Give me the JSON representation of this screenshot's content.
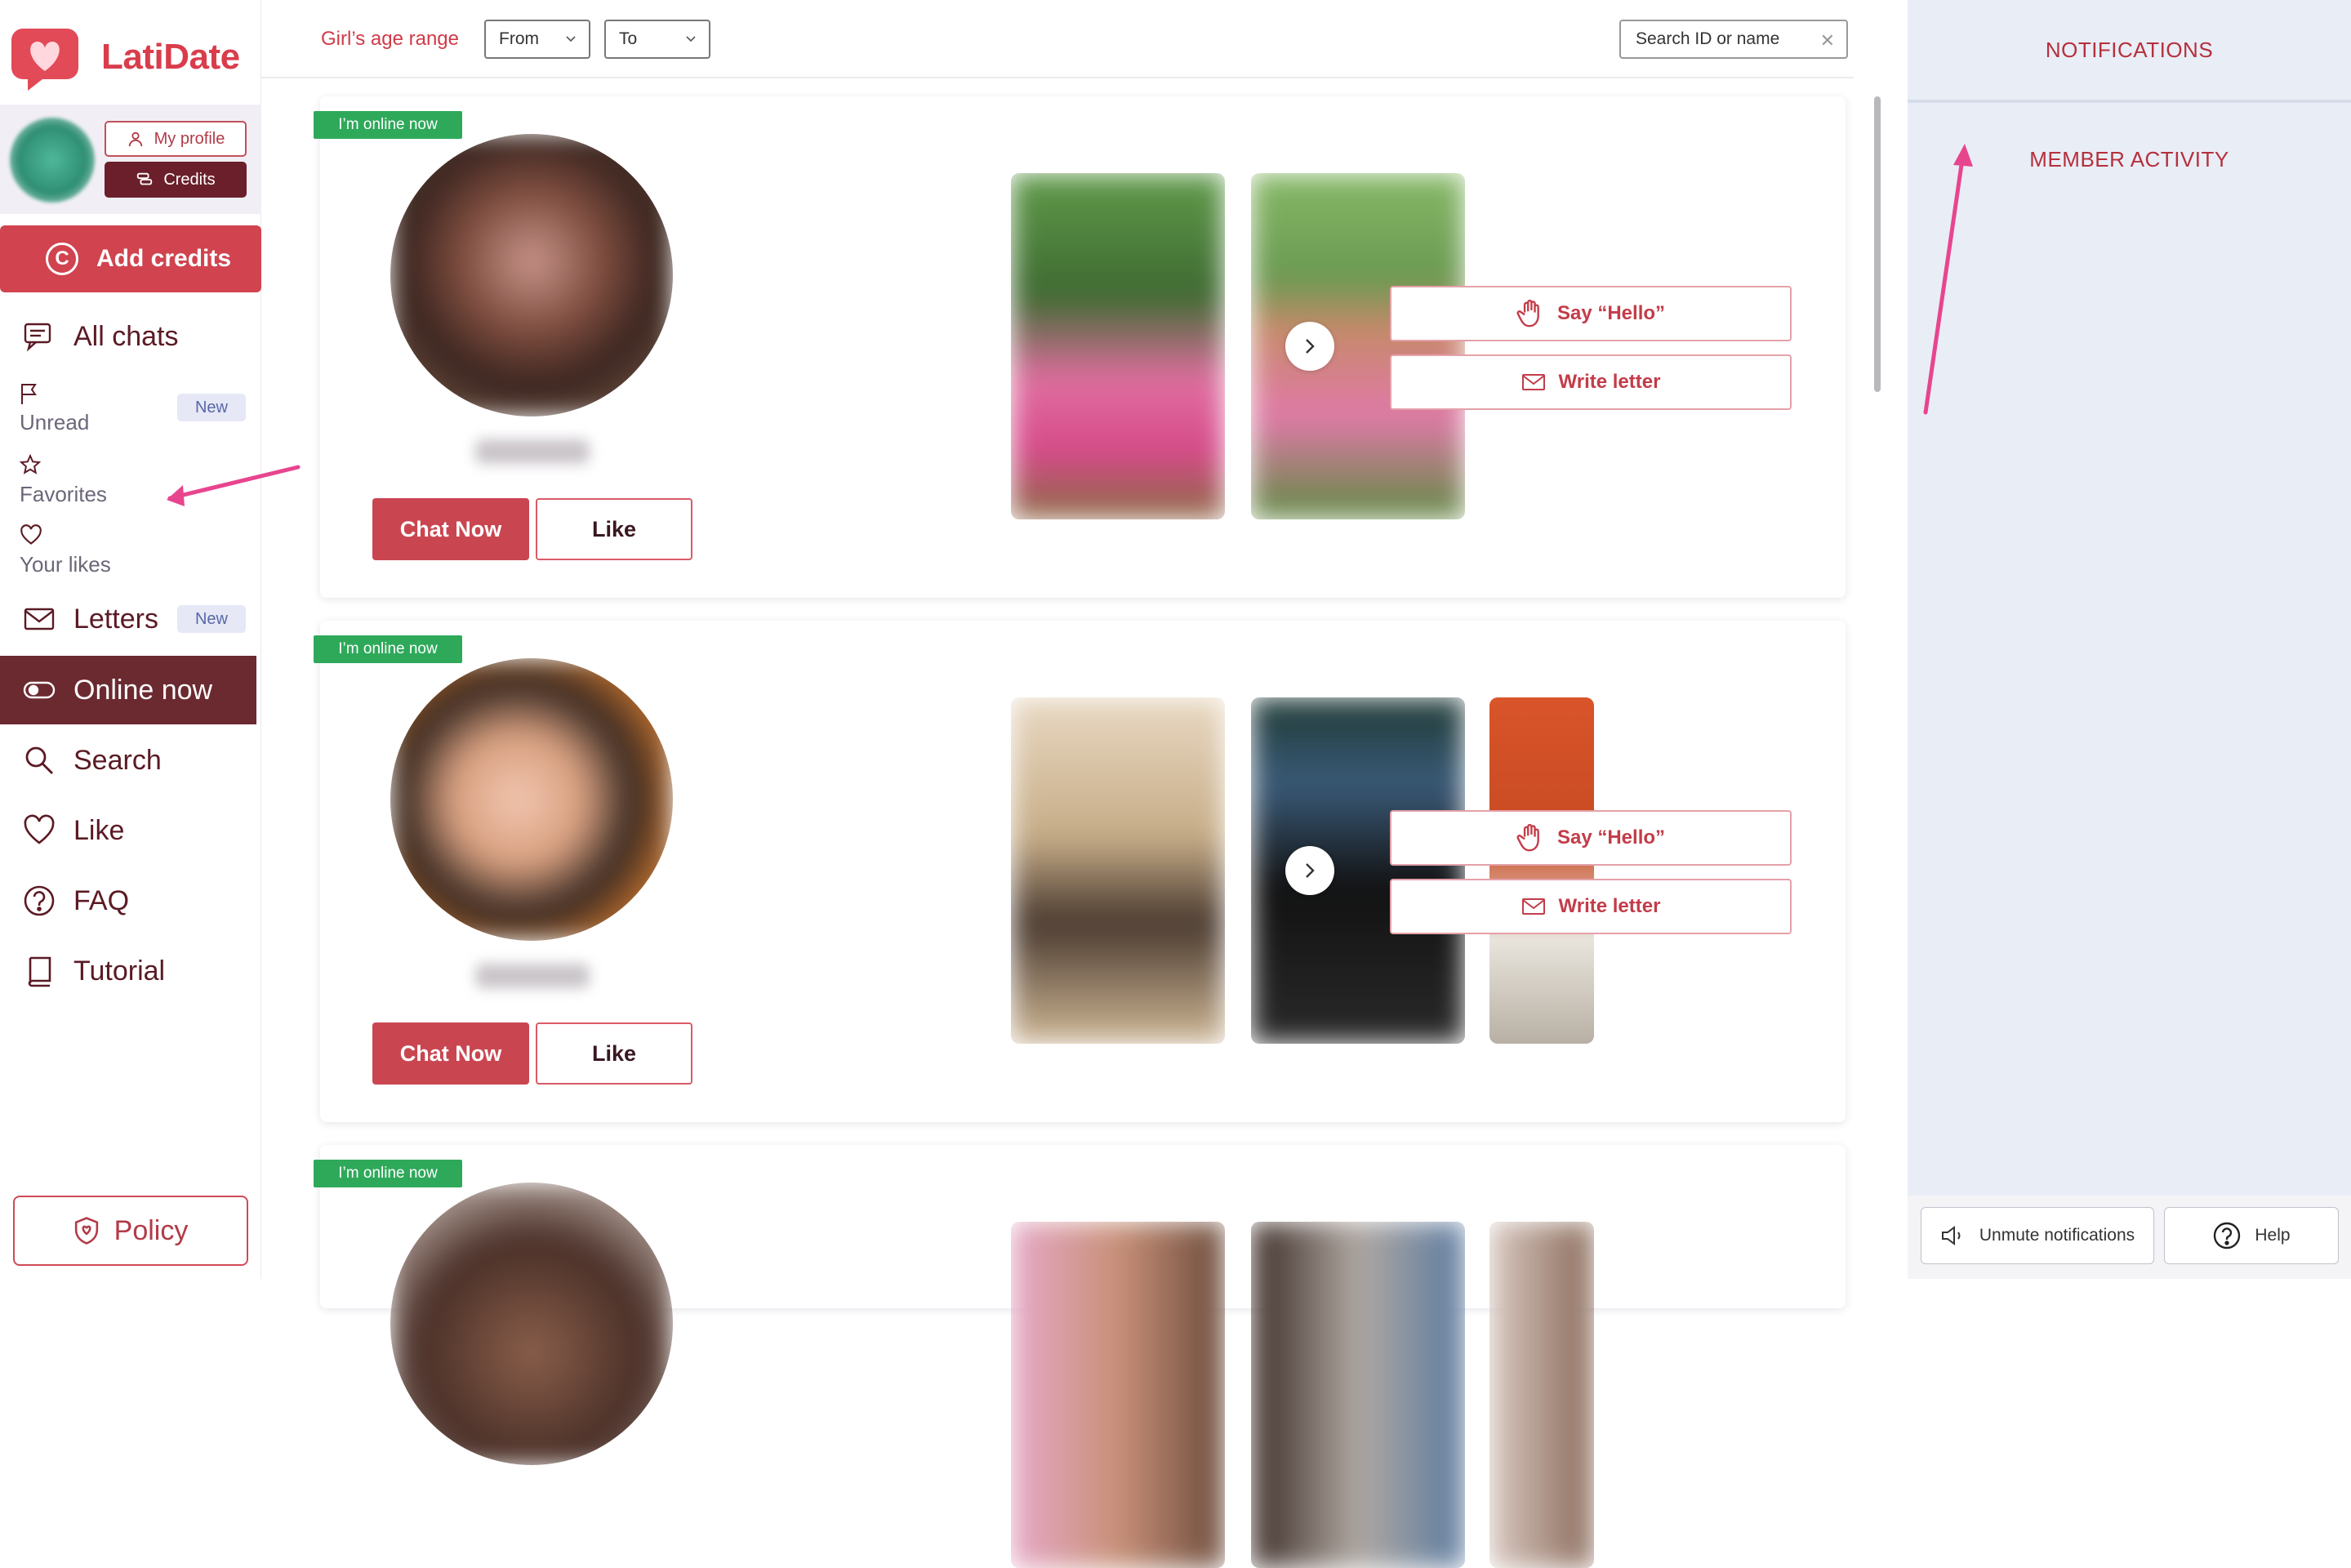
{
  "brand": {
    "name": "LatiDate"
  },
  "profile": {
    "my_profile_label": "My profile",
    "credits_label": "Credits"
  },
  "add_credits": {
    "label": "Add credits",
    "icon": "C"
  },
  "nav": {
    "all_chats": "All chats",
    "unread": "Unread",
    "favorites": "Favorites",
    "your_likes": "Your likes",
    "letters": "Letters",
    "online_now": "Online now",
    "search": "Search",
    "like": "Like",
    "faq": "FAQ",
    "tutorial": "Tutorial",
    "new_badge": "New"
  },
  "policy": {
    "label": "Policy"
  },
  "filters": {
    "age_label": "Girl’s age range",
    "from_placeholder": "From",
    "to_placeholder": "To",
    "search_placeholder": "Search ID or name"
  },
  "cards": [
    {
      "online_tag": "I’m online now",
      "chat_label": "Chat Now",
      "like_label": "Like",
      "hello_label": "Say “Hello”",
      "letter_label": "Write letter"
    },
    {
      "online_tag": "I’m online now",
      "chat_label": "Chat Now",
      "like_label": "Like",
      "hello_label": "Say “Hello”",
      "letter_label": "Write letter"
    },
    {
      "online_tag": "I’m online now"
    }
  ],
  "right_panel": {
    "notifications_title": "NOTIFICATIONS",
    "member_activity_title": "MEMBER ACTIVITY",
    "unmute_label": "Unmute notifications",
    "help_label": "Help"
  },
  "colors": {
    "brand_red": "#d93d4b",
    "dark_maroon": "#6b1f2a",
    "online_green": "#2ea95a",
    "annotation_pink": "#e8458f"
  }
}
